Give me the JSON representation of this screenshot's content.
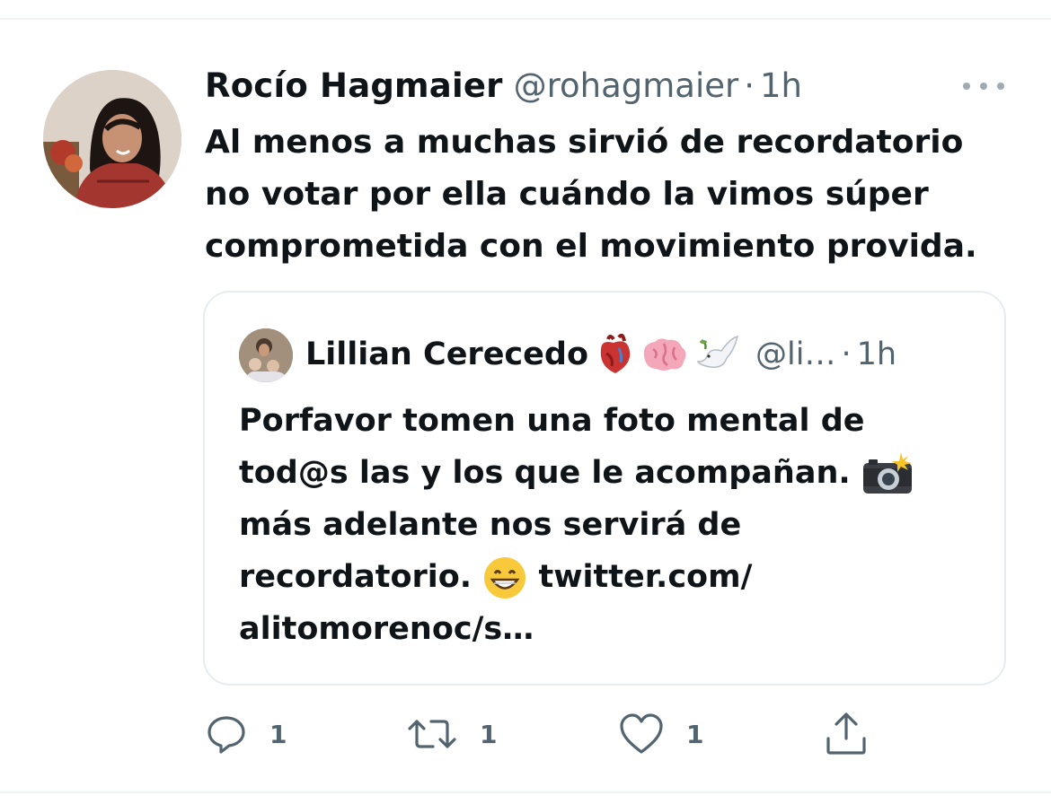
{
  "tweet": {
    "author_name": "Rocío Hagmaier",
    "handle": "@rohagmaier",
    "separator": "·",
    "time": "1h",
    "text_lines": [
      "Al menos a muchas sirvió de recordatorio",
      "no votar por ella cuándo la vimos súper",
      "comprometida con el movimiento provida."
    ]
  },
  "quote": {
    "author_name": "Lillian Cerecedo",
    "name_emojis": [
      "anatomical-heart",
      "brain",
      "dove"
    ],
    "handle": "@li…",
    "separator": "·",
    "time": "1h",
    "line1": "Porfavor tomen una foto mental de",
    "line2": "tod@s las y los que le acompañan.",
    "line3": "más adelante nos servirá de",
    "line4_text": "recordatorio.",
    "line4_link": "twitter.com/",
    "line5": "alitomorenoc/s…",
    "inline_emojis": [
      "camera-with-flash",
      "grinning-face"
    ]
  },
  "actions": {
    "reply_count": "1",
    "retweet_count": "1",
    "like_count": "1",
    "icons": [
      "reply-icon",
      "retweet-icon",
      "like-icon",
      "share-icon"
    ]
  },
  "colors": {
    "text": "#0f1419",
    "secondary": "#536471",
    "border": "#e6ecf0"
  }
}
